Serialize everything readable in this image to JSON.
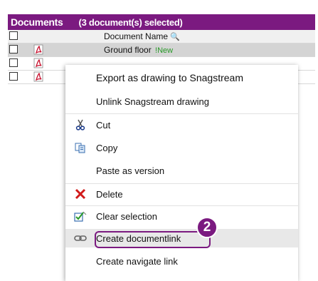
{
  "header": {
    "title": "Documents",
    "selection": "(3 document(s) selected)"
  },
  "table": {
    "column_header": "Document Name",
    "rows": [
      {
        "name": "Ground floor",
        "tag": "New"
      }
    ]
  },
  "menu": {
    "export": "Export as drawing to Snagstream",
    "unlink": "Unlink Snagstream drawing",
    "cut": "Cut",
    "copy": "Copy",
    "paste": "Paste as version",
    "delete": "Delete",
    "clear": "Clear selection",
    "create_doclink": "Create documentlink",
    "create_navlink": "Create navigate link"
  },
  "callout": {
    "number": "2"
  },
  "colors": {
    "brand": "#7b1a80",
    "delete": "#d11a1a",
    "pdf": "#c8102e"
  }
}
